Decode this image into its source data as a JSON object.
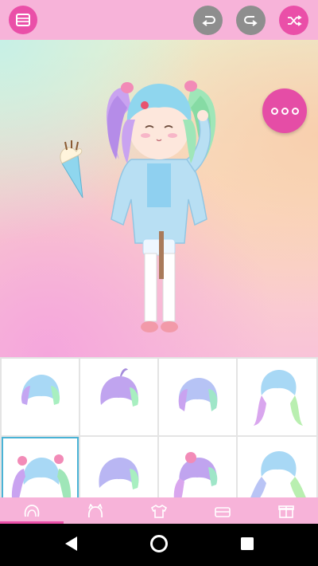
{
  "toolbar": {
    "menu_icon": "list-icon",
    "undo_icon": "undo-icon",
    "redo_icon": "redo-icon",
    "shuffle_icon": "shuffle-icon"
  },
  "stage": {
    "more_icon": "more-dots-icon",
    "held_item": "ice-cream-cone",
    "character": "pastel-chibi-girl"
  },
  "hair_options": [
    {
      "style": "bob-short",
      "selected": false
    },
    {
      "style": "bob-spiky",
      "selected": false
    },
    {
      "style": "bob-wavy",
      "selected": false
    },
    {
      "style": "long-braids",
      "selected": false
    },
    {
      "style": "twin-tails",
      "selected": true
    },
    {
      "style": "bob-round",
      "selected": false
    },
    {
      "style": "side-pony",
      "selected": false
    },
    {
      "style": "long-waves",
      "selected": false
    }
  ],
  "tabs": [
    {
      "icon": "hair-icon",
      "active": true
    },
    {
      "icon": "head-accessory-icon",
      "active": false
    },
    {
      "icon": "shirt-icon",
      "active": false
    },
    {
      "icon": "shoes-icon",
      "active": false
    },
    {
      "icon": "gift-box-icon",
      "active": false
    }
  ],
  "system_nav": {
    "back_icon": "back-triangle-icon",
    "home_icon": "home-circle-icon",
    "recents_icon": "recents-square-icon"
  },
  "colors": {
    "accent_pink": "#ea4fa8",
    "bar_pink": "#f7b3d9",
    "disabled_gray": "#8e8e8e",
    "selection_blue": "#4ab3d6"
  }
}
